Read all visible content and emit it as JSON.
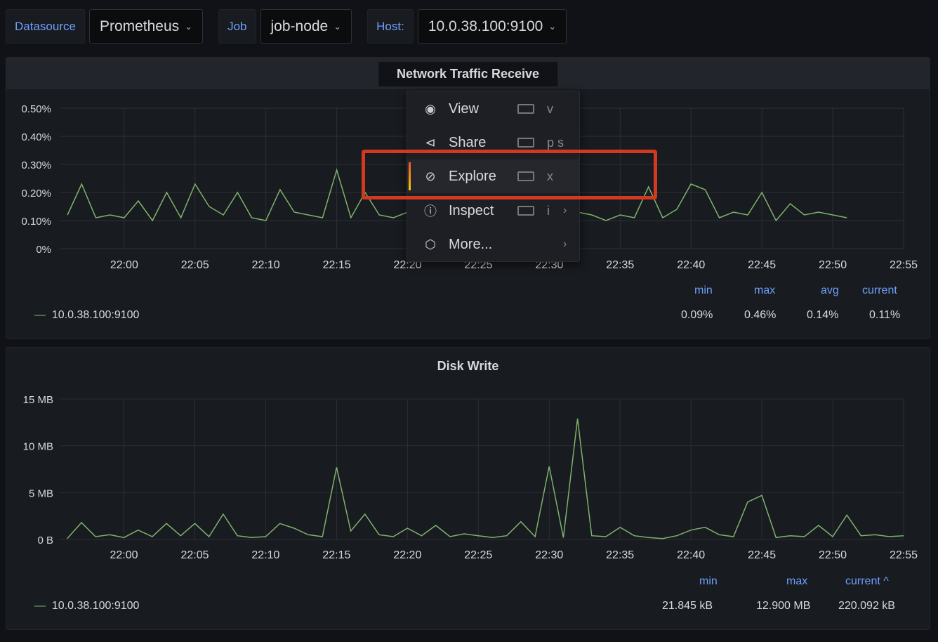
{
  "variables": [
    {
      "label": "Datasource",
      "value": "Prometheus"
    },
    {
      "label": "Job",
      "value": "job-node"
    },
    {
      "label": "Host:",
      "value": "10.0.38.100:9100"
    }
  ],
  "colors": {
    "series": "#7eb26d",
    "accent": "#6e9fff",
    "highlight": "#d2391f"
  },
  "panels": [
    {
      "title": "Network Traffic Receive",
      "legend": "10.0.38.100:9100",
      "stats": [
        {
          "label": "min",
          "value": "0.09%"
        },
        {
          "label": "max",
          "value": "0.46%"
        },
        {
          "label": "avg",
          "value": "0.14%"
        },
        {
          "label": "current",
          "value": "0.11%"
        }
      ]
    },
    {
      "title": "Disk Write",
      "legend": "10.0.38.100:9100",
      "stats": [
        {
          "label": "min",
          "value": "21.845 kB"
        },
        {
          "label": "max",
          "value": "12.900 MB"
        },
        {
          "label": "current ^",
          "value": "220.092 kB"
        }
      ]
    }
  ],
  "context_menu": [
    {
      "icon": "eye-icon",
      "label": "View",
      "shortcut": "v",
      "submenu": false
    },
    {
      "icon": "share-icon",
      "label": "Share",
      "shortcut": "p s",
      "submenu": false
    },
    {
      "icon": "compass-icon",
      "label": "Explore",
      "shortcut": "x",
      "submenu": false,
      "active": true
    },
    {
      "icon": "info-icon",
      "label": "Inspect",
      "shortcut": "i",
      "submenu": true
    },
    {
      "icon": "cube-icon",
      "label": "More...",
      "shortcut": "",
      "submenu": true
    }
  ],
  "chart_data": [
    {
      "type": "line",
      "title": "Network Traffic Receive",
      "yticks": [
        "0%",
        "0.10%",
        "0.20%",
        "0.30%",
        "0.40%",
        "0.50%"
      ],
      "ylim": [
        0,
        0.5
      ],
      "yunit": "%",
      "xticks": [
        "22:00",
        "22:05",
        "22:10",
        "22:15",
        "22:20",
        "22:25",
        "22:30",
        "22:35",
        "22:40",
        "22:45",
        "22:50",
        "22:55"
      ],
      "grid": true,
      "legend": "bottom-left",
      "series": [
        {
          "name": "10.0.38.100:9100",
          "x_start": "21:56",
          "x_step_min": 1,
          "values": [
            0.12,
            0.23,
            0.11,
            0.12,
            0.11,
            0.17,
            0.1,
            0.2,
            0.11,
            0.23,
            0.15,
            0.12,
            0.2,
            0.11,
            0.1,
            0.21,
            0.13,
            0.12,
            0.11,
            0.28,
            0.11,
            0.2,
            0.12,
            0.11,
            0.13,
            0.12,
            0.11,
            0.12,
            0.13,
            0.12,
            0.11,
            0.12,
            0.13,
            0.11,
            0.13,
            0.15,
            0.13,
            0.12,
            0.1,
            0.12,
            0.11,
            0.22,
            0.11,
            0.14,
            0.23,
            0.21,
            0.11,
            0.13,
            0.12,
            0.2,
            0.1,
            0.16,
            0.12,
            0.13,
            0.12,
            0.11
          ]
        }
      ]
    },
    {
      "type": "line",
      "title": "Disk Write",
      "yticks": [
        "0 B",
        "5 MB",
        "10 MB",
        "15 MB"
      ],
      "ylim": [
        0,
        15
      ],
      "yunit": "MB",
      "xticks": [
        "22:00",
        "22:05",
        "22:10",
        "22:15",
        "22:20",
        "22:25",
        "22:30",
        "22:35",
        "22:40",
        "22:45",
        "22:50",
        "22:55"
      ],
      "grid": true,
      "legend": "bottom-left",
      "series": [
        {
          "name": "10.0.38.100:9100",
          "x_start": "21:56",
          "x_step_min": 1,
          "values": [
            0.1,
            1.8,
            0.3,
            0.5,
            0.2,
            1.0,
            0.3,
            1.7,
            0.4,
            1.7,
            0.3,
            2.7,
            0.4,
            0.2,
            0.3,
            1.7,
            1.2,
            0.5,
            0.3,
            7.7,
            0.9,
            2.7,
            0.5,
            0.3,
            1.2,
            0.4,
            1.5,
            0.3,
            0.6,
            0.4,
            0.2,
            0.4,
            1.9,
            0.3,
            7.8,
            0.2,
            12.9,
            0.4,
            0.3,
            1.3,
            0.4,
            0.2,
            0.1,
            0.4,
            1.0,
            1.3,
            0.5,
            0.3,
            4.0,
            4.7,
            0.2,
            0.4,
            0.3,
            1.5,
            0.3,
            2.6,
            0.4,
            0.5,
            0.3,
            0.4
          ]
        }
      ]
    }
  ]
}
